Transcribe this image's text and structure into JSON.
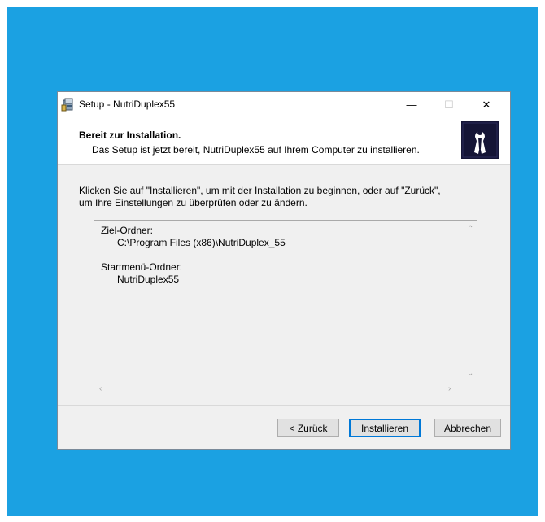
{
  "window": {
    "title": "Setup - NutriDuplex55",
    "minimize_glyph": "—",
    "maximize_glyph": "☐",
    "close_glyph": "✕"
  },
  "header": {
    "title": "Bereit zur Installation.",
    "subtitle": "Das Setup ist jetzt bereit, NutriDuplex55 auf Ihrem Computer zu installieren."
  },
  "content": {
    "line1": "Klicken Sie auf \"Installieren\", um mit der Installation zu beginnen, oder auf \"Zurück\",",
    "line2": "um Ihre Einstellungen zu überprüfen oder zu ändern."
  },
  "memo": {
    "text": "Ziel-Ordner:\n      C:\\Program Files (x86)\\NutriDuplex_55\n\nStartmenü-Ordner:\n      NutriDuplex55"
  },
  "buttons": {
    "back": "< Zurück",
    "install": "Installieren",
    "cancel": "Abbrechen"
  },
  "colors": {
    "desktop": "#1ba1e2",
    "accent": "#0078d7"
  }
}
